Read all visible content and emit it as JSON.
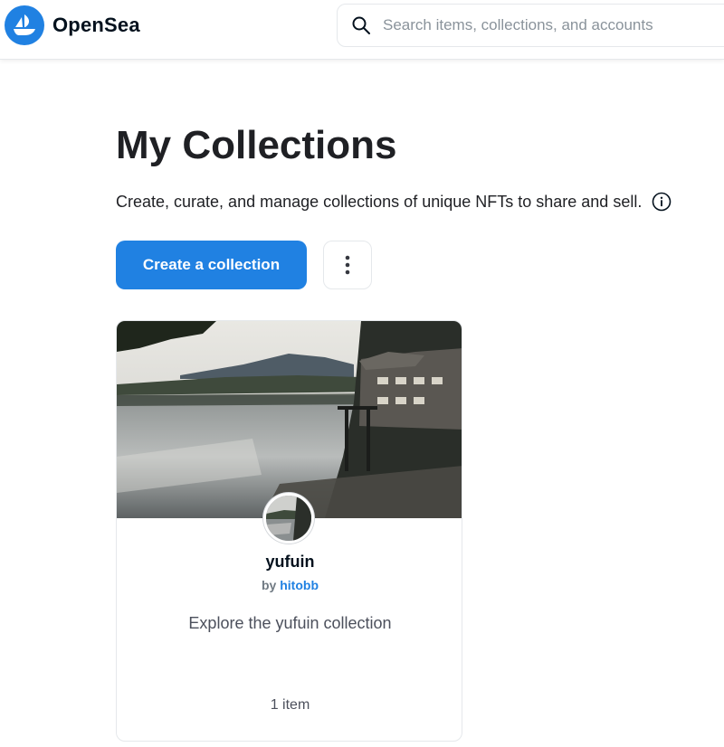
{
  "brand": {
    "name": "OpenSea",
    "logo_icon": "opensea-logo-icon",
    "accent": "#2081e2"
  },
  "search": {
    "placeholder": "Search items, collections, and accounts",
    "value": ""
  },
  "page": {
    "title": "My Collections",
    "subtitle": "Create, curate, and manage collections of unique NFTs to share and sell.",
    "info_icon": "info-icon"
  },
  "actions": {
    "create_label": "Create a collection",
    "more_icon": "more-vertical-icon"
  },
  "collections": [
    {
      "name": "yufuin",
      "by_prefix": "by",
      "author": "hitobb",
      "description": "Explore the yufuin collection",
      "item_count": "1 item"
    }
  ]
}
